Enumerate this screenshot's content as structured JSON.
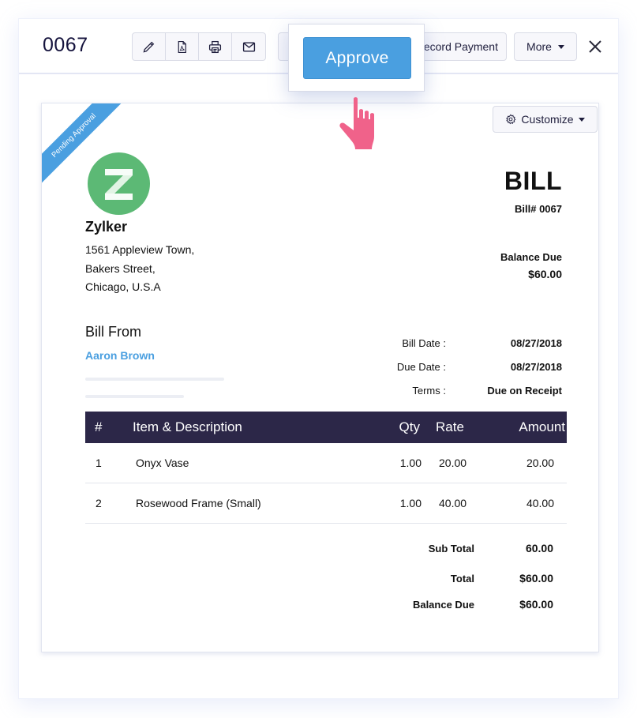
{
  "header": {
    "doc_number": "0067",
    "toolbar_icons": [
      "pencil-icon",
      "pdf-icon",
      "printer-icon",
      "mail-icon"
    ],
    "record_payment_label": "Record Payment",
    "more_label": "More",
    "close_icon": "close-icon"
  },
  "approve_popover": {
    "approve_label": "Approve"
  },
  "bill": {
    "status_ribbon": "Pending Approval",
    "customize_label": "Customize",
    "company": {
      "logo_letter": "Z",
      "name": "Zylker",
      "address": [
        "1561 Appleview Town,",
        "Bakers Street,",
        "Chicago, U.S.A"
      ]
    },
    "title": "BILL",
    "bill_number": "Bill# 0067",
    "balance_due_label": "Balance Due",
    "balance_due_value": "$60.00",
    "bill_from_label": "Bill From",
    "vendor_name": "Aaron Brown",
    "meta": [
      {
        "label": "Bill Date :",
        "value": "08/27/2018"
      },
      {
        "label": "Due Date :",
        "value": "08/27/2018"
      },
      {
        "label": "Terms :",
        "value": "Due on Receipt"
      }
    ],
    "items_table": {
      "columns": [
        "#",
        "Item & Description",
        "Qty",
        "Rate",
        "Amount"
      ],
      "rows": [
        {
          "num": "1",
          "desc": "Onyx Vase",
          "qty": "1.00",
          "rate": "20.00",
          "amount": "20.00"
        },
        {
          "num": "2",
          "desc": "Rosewood Frame (Small)",
          "qty": "1.00",
          "rate": "40.00",
          "amount": "40.00"
        }
      ]
    },
    "totals": [
      {
        "label": "Sub Total",
        "value": "60.00"
      },
      {
        "label": "Total",
        "value": "$60.00"
      },
      {
        "label": "Balance Due",
        "value": "$60.00"
      }
    ]
  },
  "colors": {
    "accent_blue": "#4a9fe0",
    "table_header": "#2c2748",
    "logo_green": "#5cb975",
    "cursor_pink": "#f0628a",
    "title_navy": "#15133d"
  }
}
